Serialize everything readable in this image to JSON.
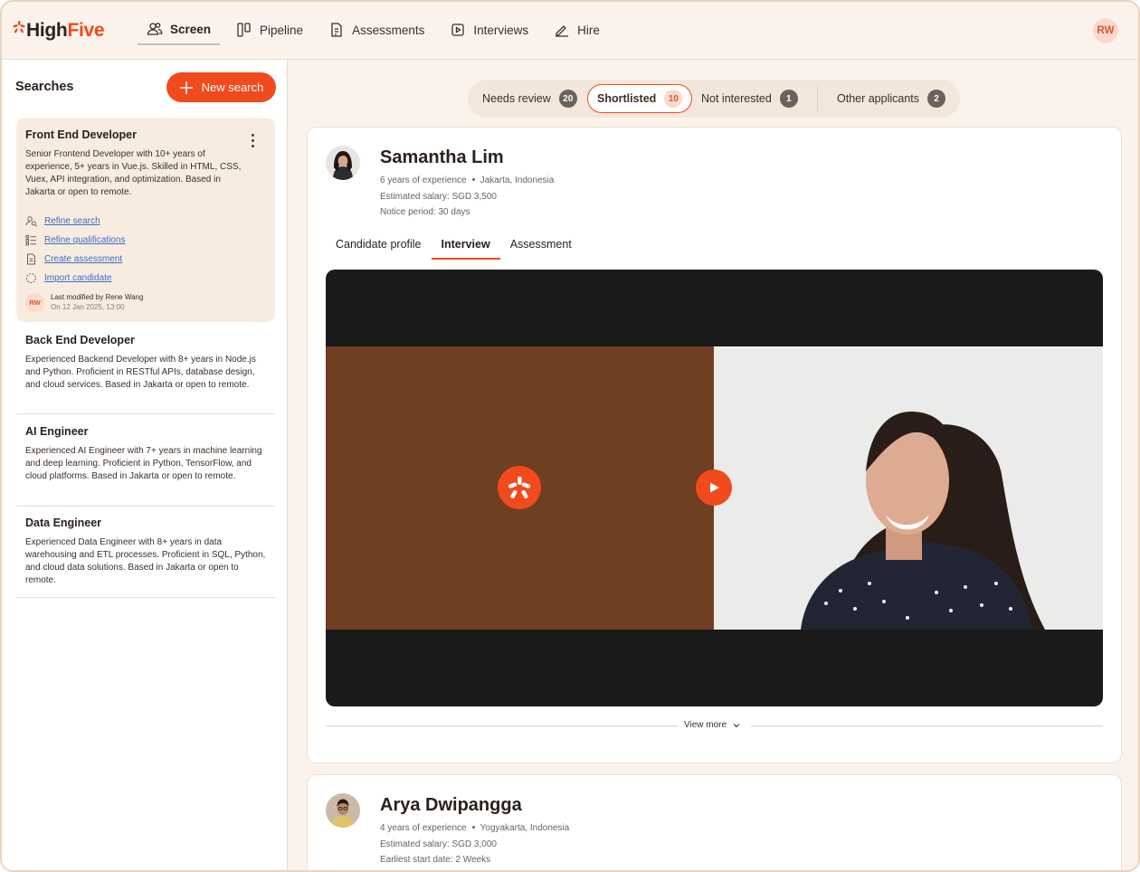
{
  "app": {
    "logo_text_1": "High",
    "logo_text_2": "Five",
    "user_initials": "RW"
  },
  "nav": {
    "items": [
      {
        "label": "Screen",
        "icon": "users-icon",
        "active": true
      },
      {
        "label": "Pipeline",
        "icon": "kanban-icon"
      },
      {
        "label": "Assessments",
        "icon": "document-icon"
      },
      {
        "label": "Interviews",
        "icon": "video-icon"
      },
      {
        "label": "Hire",
        "icon": "signature-icon"
      }
    ]
  },
  "sidebar": {
    "title": "Searches",
    "new_search_label": "New search",
    "active_search": {
      "title": "Front End Developer",
      "description": "Senior Frontend Developer with 10+ years of experience, 5+ years in Vue.js. Skilled in HTML, CSS, Vuex, API integration, and optimization. Based in Jakarta or open to remote.",
      "links": [
        {
          "label": "Refine search",
          "icon": "search-user-icon"
        },
        {
          "label": "Refine qualifications",
          "icon": "list-icon"
        },
        {
          "label": "Create assessment",
          "icon": "document-icon"
        },
        {
          "label": "Import candidate",
          "icon": "dashed-circle-icon"
        }
      ],
      "modified_initials": "RW",
      "modified_by": "Last modified by Rene Wang",
      "modified_on": "On 12 Jan 2025, 13:00"
    },
    "searches": [
      {
        "title": "Back End Developer",
        "description": "Experienced Backend Developer with 8+ years in Node.js and Python. Proficient in RESTful APIs, database design, and cloud services. Based in Jakarta or open to remote."
      },
      {
        "title": "AI Engineer",
        "description": "Experienced AI Engineer with 7+ years in machine learning and deep learning. Proficient in Python, TensorFlow, and cloud platforms. Based in Jakarta or open to remote."
      },
      {
        "title": "Data Engineer",
        "description": "Experienced Data Engineer with 8+ years in data warehousing and ETL processes. Proficient in SQL, Python, and cloud data solutions. Based in Jakarta or open to remote."
      }
    ]
  },
  "filters": [
    {
      "label": "Needs review",
      "count": "20"
    },
    {
      "label": "Shortlisted",
      "count": "10",
      "active": true
    },
    {
      "label": "Not interested",
      "count": "1"
    },
    {
      "label": "Other applicants",
      "count": "2"
    }
  ],
  "candidates": [
    {
      "name": "Samantha Lim",
      "experience": "6 years of experience",
      "location": "Jakarta, Indonesia",
      "salary": "Estimated salary: SGD 3,500",
      "availability": "Notice period: 30 days",
      "tabs": [
        "Candidate profile",
        "Interview",
        "Assessment"
      ],
      "active_tab": "Interview",
      "view_more": "View more"
    },
    {
      "name": "Arya Dwipangga",
      "experience": "4 years of experience",
      "location": "Yogyakarta, Indonesia",
      "salary": "Estimated salary: SGD 3,000",
      "availability": "Earliest start date: 2 Weeks"
    }
  ],
  "colors": {
    "brand": "#f04a1d",
    "background": "#fbf3eb",
    "active_card": "#f8ece1"
  }
}
